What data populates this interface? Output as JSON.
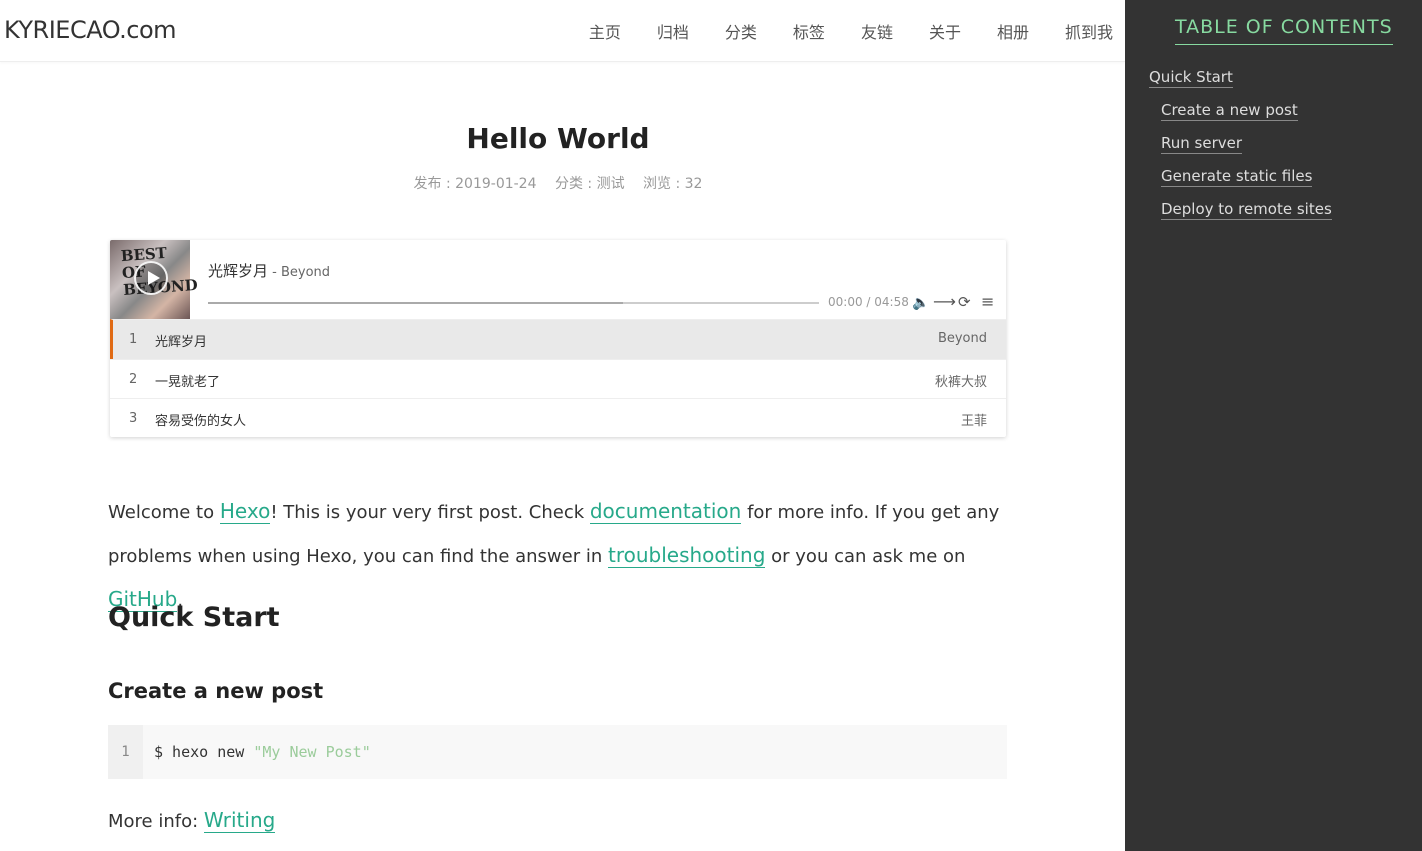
{
  "header": {
    "logo": "KYRIECAO.com",
    "nav": [
      "主页",
      "归档",
      "分类",
      "标签",
      "友链",
      "关于",
      "相册",
      "抓到我"
    ]
  },
  "toc": {
    "title": "TABLE OF CONTENTS",
    "items": [
      {
        "label": "Quick Start",
        "level": 1
      },
      {
        "label": "Create a new post",
        "level": 2
      },
      {
        "label": "Run server",
        "level": 2
      },
      {
        "label": "Generate static files",
        "level": 2
      },
      {
        "label": "Deploy to remote sites",
        "level": 2
      }
    ]
  },
  "post": {
    "title": "Hello World",
    "meta_date": "发布 : 2019-01-24",
    "meta_category": "分类 : 测试",
    "meta_views": "浏览 :  32"
  },
  "player": {
    "cover_text": "BEST OF BEYOND",
    "song": "光辉岁月",
    "artist": " - Beyond",
    "time": "00:00 / 04:58",
    "progress": 0.68,
    "playlist": [
      {
        "num": "1",
        "name": "光辉岁月",
        "artist": "Beyond"
      },
      {
        "num": "2",
        "name": "一晃就老了",
        "artist": "秋裤大叔"
      },
      {
        "num": "3",
        "name": "容易受伤的女人",
        "artist": "王菲"
      }
    ]
  },
  "content": {
    "p1_a": "Welcome to ",
    "link_hexo": "Hexo",
    "p1_b": "! This is your very first post. Check ",
    "link_docs": "documentation",
    "p1_c": " for more info. If you get any problems when using Hexo, you can find the answer in ",
    "link_trouble": "troubleshooting",
    "p1_d": " or you can ask me on ",
    "link_github": "GitHub",
    "p1_e": ".",
    "h2": "Quick Start",
    "h3": "Create a new post",
    "code_line_no": "1",
    "code_cmd": "$ hexo new ",
    "code_str": "\"My New Post\"",
    "more_label": "More info: ",
    "more_link": "Writing"
  },
  "colors": {
    "accent": "#27a98a",
    "toc_accent": "#87daa0",
    "sidebar_bg": "#333333",
    "active_track": "#e06a14"
  }
}
